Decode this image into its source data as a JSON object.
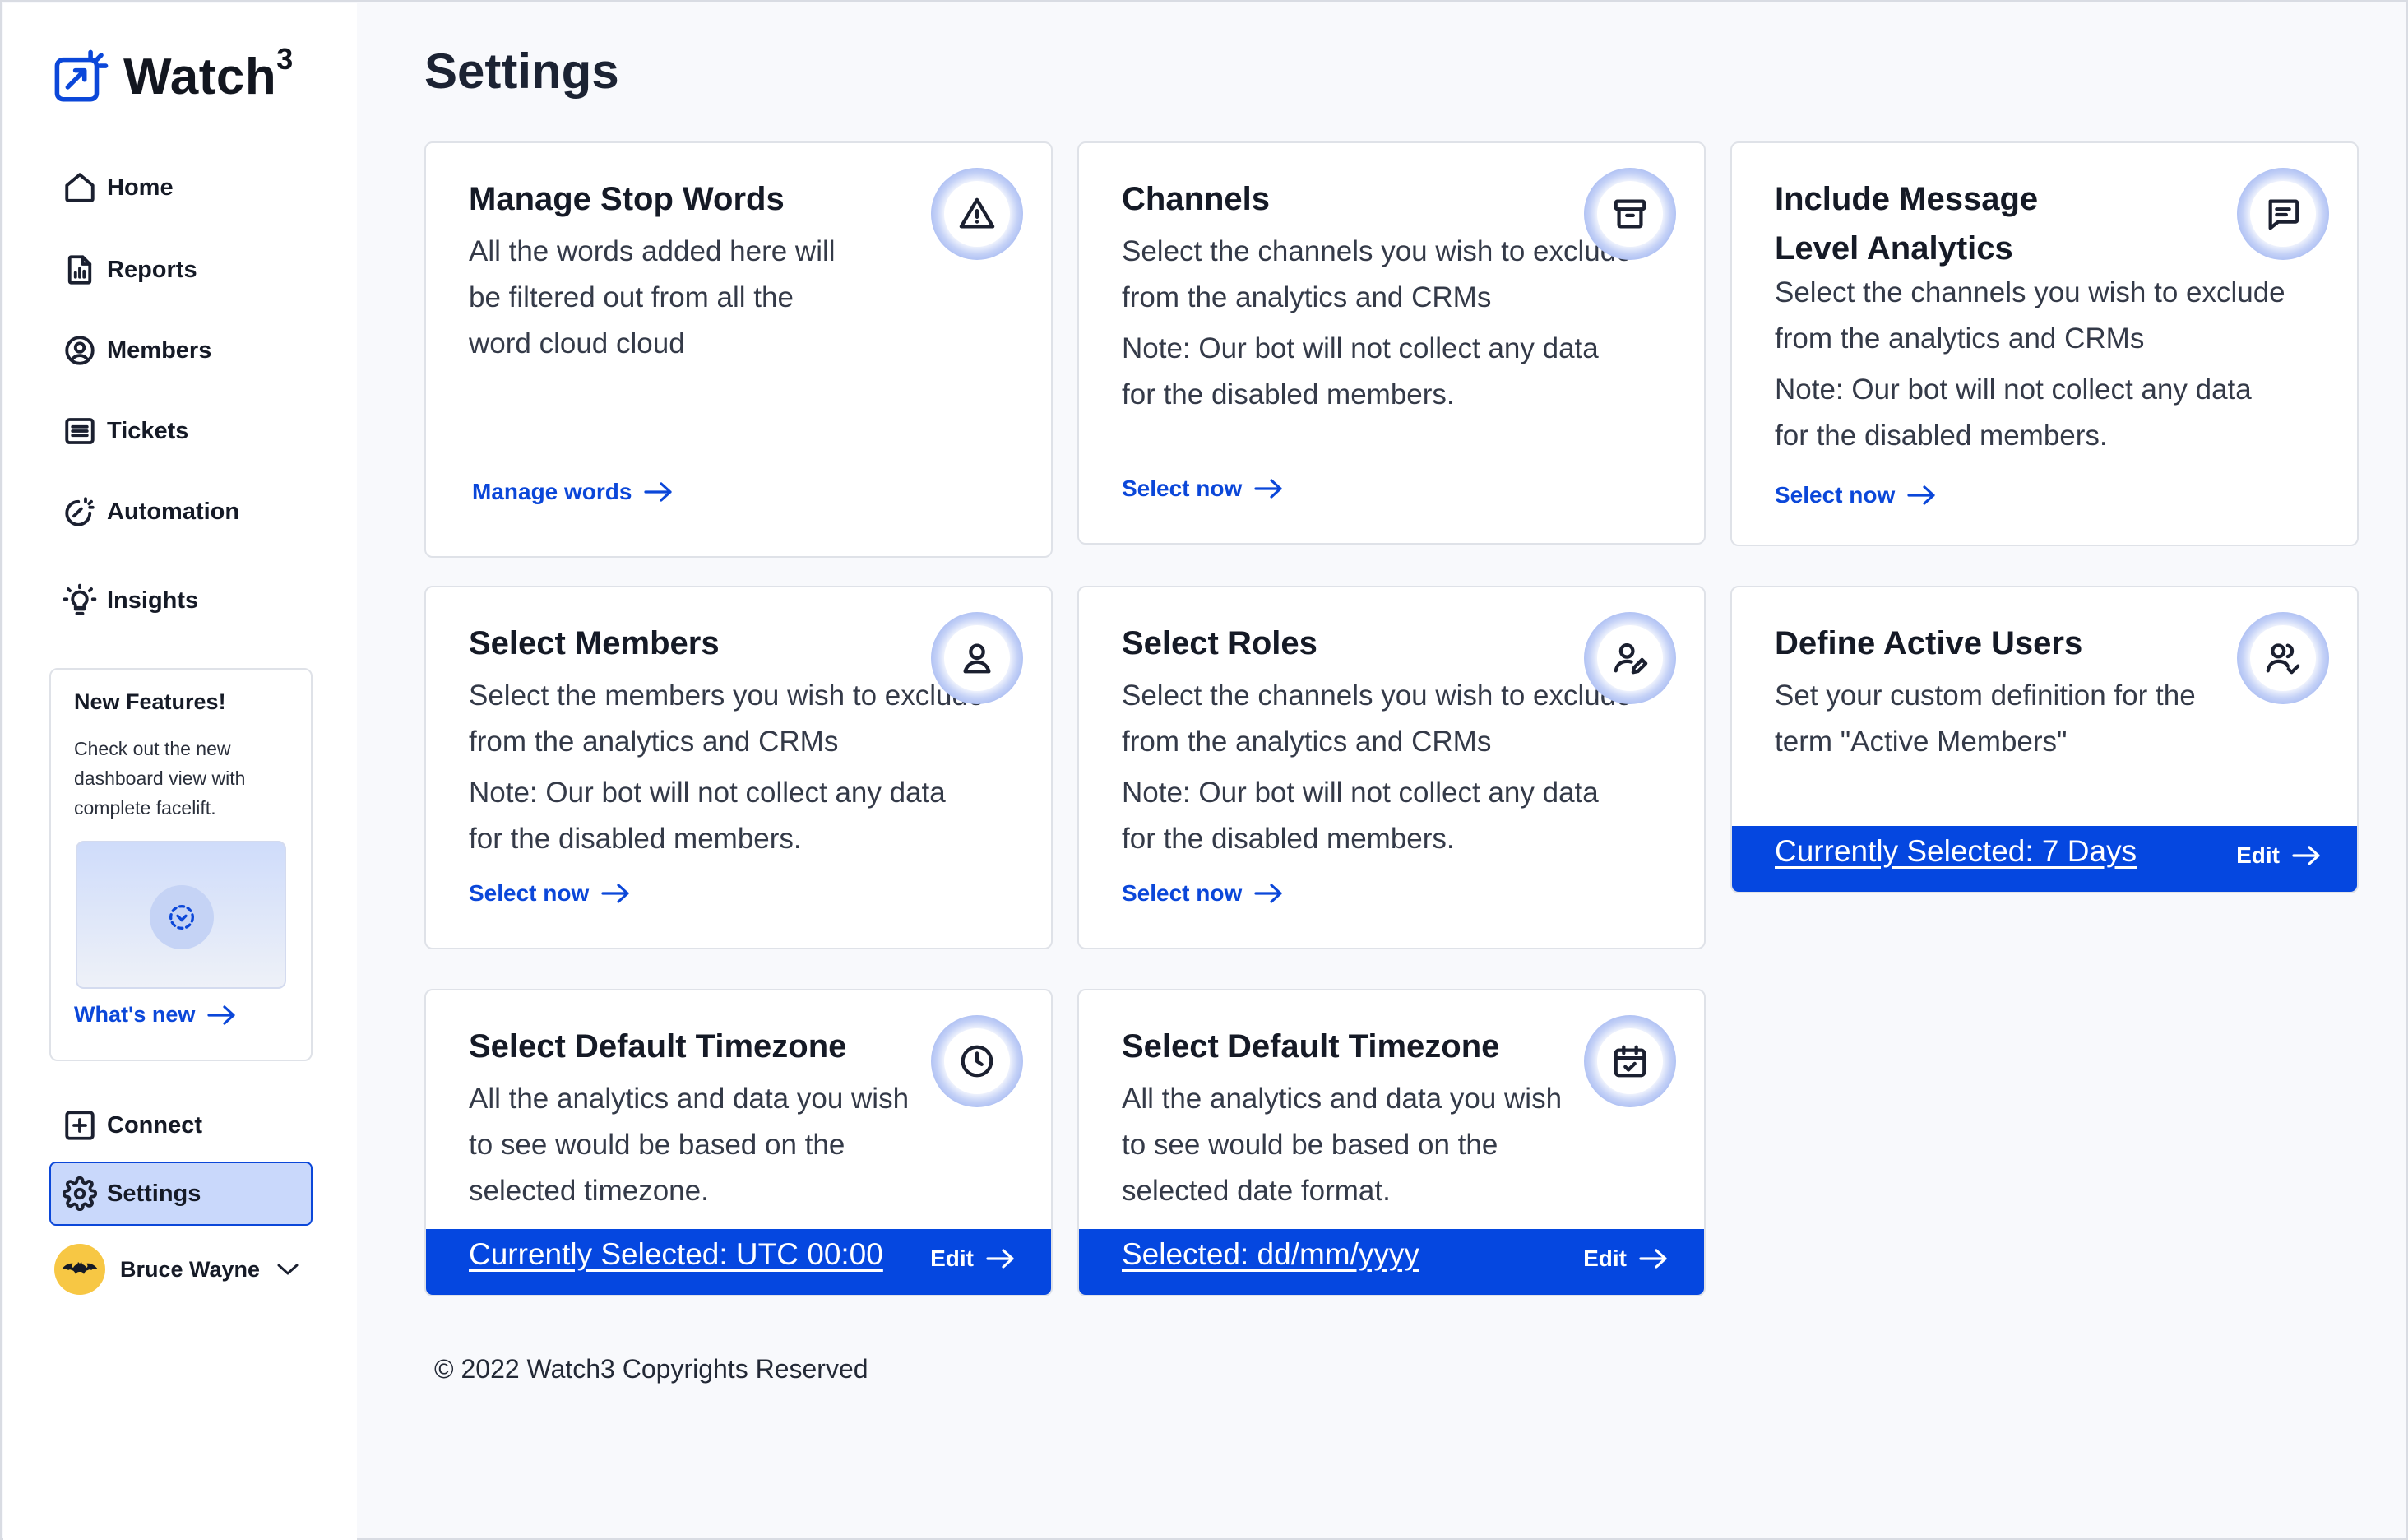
{
  "app": {
    "name": "Watch",
    "name_sup": "3"
  },
  "sidebar": {
    "items": [
      {
        "label": "Home",
        "icon": "home-icon"
      },
      {
        "label": "Reports",
        "icon": "reports-icon"
      },
      {
        "label": "Members",
        "icon": "members-icon"
      },
      {
        "label": "Tickets",
        "icon": "tickets-icon"
      },
      {
        "label": "Automation",
        "icon": "automation-icon"
      },
      {
        "label": "Insights",
        "icon": "insights-icon"
      }
    ],
    "features": {
      "title": "New Features!",
      "description": "Check out the new dashboard view with complete facelift.",
      "link": "What's new"
    },
    "bottom_items": [
      {
        "label": "Connect",
        "icon": "plus-square-icon"
      },
      {
        "label": "Settings",
        "icon": "gear-icon",
        "selected": true
      }
    ],
    "user": {
      "name": "Bruce Wayne"
    }
  },
  "main": {
    "title": "Settings",
    "cards": [
      {
        "title": "Manage Stop Words",
        "desc1": "All the words added here will be filtered out from all the word cloud cloud",
        "link": "Manage words",
        "icon": "warning-icon"
      },
      {
        "title": "Channels",
        "desc1": "Select the channels you wish to exclude from the analytics and CRMs",
        "desc2": "Note: Our bot will not collect any data for the disabled members.",
        "link": "Select now",
        "icon": "archive-icon"
      },
      {
        "title": "Include Message Level Analytics",
        "desc1": "Select the channels you wish to exclude from the analytics and CRMs",
        "desc2": "Note: Our bot will not collect any data for the disabled members.",
        "link": "Select now",
        "icon": "message-icon"
      },
      {
        "title": "Select Members",
        "desc1": "Select the members you wish to exclude from the analytics and CRMs",
        "desc2": "Note: Our bot will not collect any data for the disabled members.",
        "link": "Select now",
        "icon": "user-icon"
      },
      {
        "title": "Select Roles",
        "desc1": "Select the channels you wish to exclude from the analytics and CRMs",
        "desc2": "Note: Our bot will not collect any data for the disabled members.",
        "link": "Select now",
        "icon": "user-edit-icon"
      },
      {
        "title": "Define Active Users",
        "desc1": "Set your custom definition for the term \"Active Members\"",
        "bar_value": "Currently Selected: 7 Days",
        "bar_edit": "Edit",
        "icon": "users-check-icon"
      },
      {
        "title": "Select Default Timezone",
        "desc1": "All the analytics and data you wish to see would be based on the selected timezone.",
        "bar_value": "Currently Selected: UTC 00:00",
        "bar_edit": "Edit",
        "icon": "clock-icon"
      },
      {
        "title": "Select Default Timezone",
        "desc1": "All the analytics and data you wish to see would be based on the selected date format.",
        "bar_value": "Selected: dd/mm/yyyy",
        "bar_edit": "Edit",
        "icon": "calendar-check-icon"
      }
    ]
  },
  "footer": {
    "text": "© 2022 Watch3 Copyrights Reserved"
  },
  "colors": {
    "accent": "#0547e0",
    "link": "#0b47d9",
    "selected_bg": "#c9d8fb",
    "avatar": "#f7c744"
  }
}
